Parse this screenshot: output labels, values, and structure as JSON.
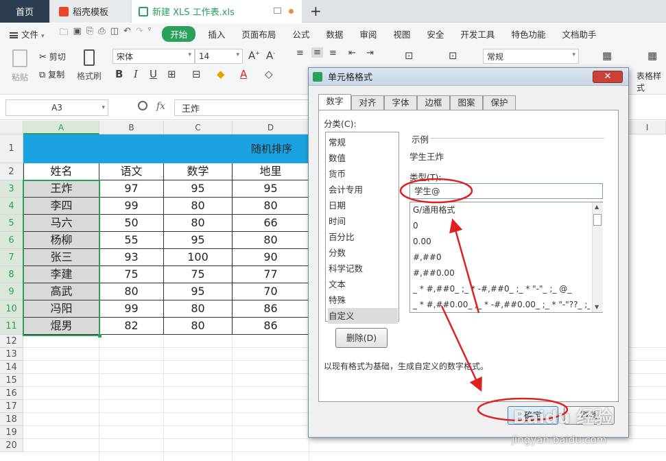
{
  "tabs": {
    "home": "首页",
    "template": "稻壳模板",
    "file": "新建 XLS 工作表.xls",
    "plus": "+"
  },
  "menu": {
    "file": "文件",
    "start": "开始",
    "items": [
      "插入",
      "页面布局",
      "公式",
      "数据",
      "审阅",
      "视图",
      "安全",
      "开发工具",
      "特色功能",
      "文档助手"
    ]
  },
  "toolbar": {
    "paste": "粘贴",
    "cut": "剪切",
    "copy": "复制",
    "format_painter": "格式刷",
    "font_name": "宋体",
    "font_size": "14",
    "number_format": "常规",
    "table_style": "表格样式"
  },
  "formula_bar": {
    "cell_ref": "A3",
    "fx": "fx",
    "value": "王炸"
  },
  "sheet": {
    "col_headers": [
      "A",
      "B",
      "C",
      "D",
      "I"
    ],
    "row_headers": [
      "1",
      "2",
      "3",
      "4",
      "5",
      "6",
      "7",
      "8",
      "9",
      "10",
      "11",
      "12",
      "13",
      "14",
      "15",
      "16",
      "17",
      "18",
      "19",
      "20"
    ],
    "title_text": "随机排序",
    "table_headers": [
      "姓名",
      "语文",
      "数学",
      "地里"
    ],
    "rows": [
      [
        "王炸",
        "97",
        "95",
        "95"
      ],
      [
        "李四",
        "99",
        "80",
        "80"
      ],
      [
        "马六",
        "50",
        "80",
        "66"
      ],
      [
        "杨柳",
        "55",
        "95",
        "80"
      ],
      [
        "张三",
        "93",
        "100",
        "90"
      ],
      [
        "李建",
        "75",
        "75",
        "77"
      ],
      [
        "高武",
        "80",
        "95",
        "70"
      ],
      [
        "冯阳",
        "99",
        "80",
        "86"
      ],
      [
        "焜男",
        "82",
        "80",
        "86"
      ]
    ],
    "title_color": "#1aa3e0",
    "selection_color": "#2aa05b"
  },
  "dialog": {
    "title": "单元格格式",
    "close": "✕",
    "tabs": [
      "数字",
      "对齐",
      "字体",
      "边框",
      "图案",
      "保护"
    ],
    "category_label": "分类(C):",
    "categories": [
      "常规",
      "数值",
      "货币",
      "会计专用",
      "日期",
      "时间",
      "百分比",
      "分数",
      "科学记数",
      "文本",
      "特殊",
      "自定义"
    ],
    "sample_label": "示例",
    "sample_value": "学生王炸",
    "type_label": "类型(T):",
    "type_value": "学生@",
    "formats": [
      "G/通用格式",
      "0",
      "0.00",
      "#,##0",
      "#,##0.00",
      "_ * #,##0_ ;_ * -#,##0_ ;_ * \"-\"_ ;_ @_",
      "_ * #,##0.00_ ;_ * -#,##0.00_ ;_ * \"-\"??_ ;_ @_"
    ],
    "delete_button": "删除(D)",
    "description": "以现有格式为基础，生成自定义的数字格式。",
    "ok_button": "确定",
    "cancel_button": "取消"
  },
  "watermark": {
    "brand": "Baidu 经验",
    "url": "jingyan.baidu.com"
  },
  "annotation_color": "#e02020"
}
